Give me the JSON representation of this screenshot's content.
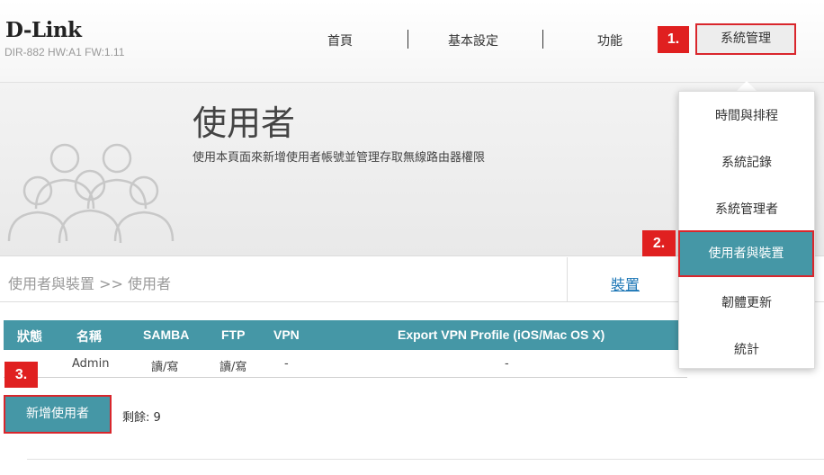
{
  "header": {
    "brand": "D-Link",
    "model": "DIR-882 HW:A1 FW:1.11",
    "nav": {
      "home": "首頁",
      "basic": "基本設定",
      "features": "功能",
      "management": "系統管理"
    }
  },
  "steps": {
    "s1": "1.",
    "s2": "2.",
    "s3": "3."
  },
  "hero": {
    "title": "使用者",
    "description": "使用本頁面來新增使用者帳號並管理存取無線路由器權限"
  },
  "breadcrumb": {
    "path": "使用者與裝置 >> 使用者",
    "device_tab": "裝置"
  },
  "table": {
    "headers": [
      "狀態",
      "名稱",
      "SAMBA",
      "FTP",
      "VPN",
      "Export VPN Profile (iOS/Mac OS X)"
    ],
    "rows": [
      {
        "status": "",
        "name": "Admin",
        "samba": "讀/寫",
        "ftp": "讀/寫",
        "vpn": "-",
        "export": "-"
      }
    ]
  },
  "actions": {
    "add_user": "新增使用者",
    "remaining": "剩餘: 9"
  },
  "dropdown": {
    "items": [
      "時間與排程",
      "系統記錄",
      "系統管理者",
      "使用者與裝置",
      "韌體更新",
      "統計"
    ],
    "active_index": 3
  },
  "colors": {
    "accent": "#4597a6",
    "highlight_border": "#d9262c",
    "badge": "#e02020"
  }
}
